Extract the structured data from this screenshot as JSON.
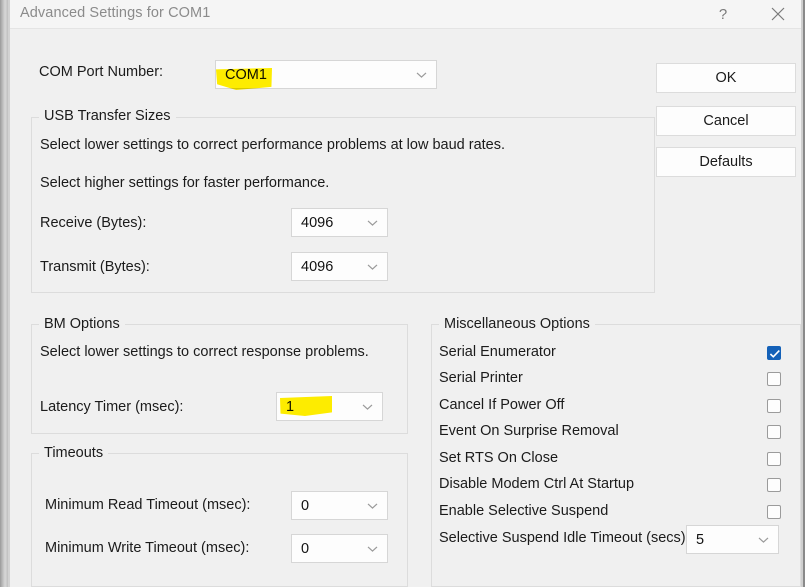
{
  "window": {
    "title": "Advanced Settings for COM1",
    "help_icon": "help-icon",
    "help_glyph": "?",
    "close_icon": "close-icon"
  },
  "com_port": {
    "label": "COM Port Number:",
    "value": "COM1",
    "highlighted": true
  },
  "buttons": {
    "ok": "OK",
    "cancel": "Cancel",
    "defaults": "Defaults"
  },
  "usb_transfer_sizes": {
    "title": "USB Transfer Sizes",
    "desc_line1": "Select lower settings to correct performance problems at low baud rates.",
    "desc_line2": "Select higher settings for faster performance.",
    "receive_label": "Receive (Bytes):",
    "receive_value": "4096",
    "transmit_label": "Transmit (Bytes):",
    "transmit_value": "4096"
  },
  "bm_options": {
    "title": "BM Options",
    "desc": "Select lower settings to correct response problems.",
    "latency_label": "Latency Timer (msec):",
    "latency_value": "1",
    "highlighted": true
  },
  "timeouts": {
    "title": "Timeouts",
    "min_read_label": "Minimum Read Timeout (msec):",
    "min_read_value": "0",
    "min_write_label": "Minimum Write Timeout (msec):",
    "min_write_value": "0"
  },
  "misc_options": {
    "title": "Miscellaneous Options",
    "items": [
      {
        "label": "Serial Enumerator",
        "checked": true
      },
      {
        "label": "Serial Printer",
        "checked": false
      },
      {
        "label": "Cancel If Power Off",
        "checked": false
      },
      {
        "label": "Event On Surprise Removal",
        "checked": false
      },
      {
        "label": "Set RTS On Close",
        "checked": false
      },
      {
        "label": "Disable Modem Ctrl At Startup",
        "checked": false
      },
      {
        "label": "Enable Selective Suspend",
        "checked": false
      }
    ],
    "idle_timeout_label": "Selective Suspend Idle Timeout (secs):",
    "idle_timeout_value": "5"
  },
  "colors": {
    "dialog_bg": "#f0f0f0",
    "titlebar_bg": "#f5f5f5",
    "accent_checkbox": "#1461b8",
    "marker_yellow": "#ffee00",
    "field_bg": "#fdfdfd",
    "border": "#dcdcdc"
  }
}
